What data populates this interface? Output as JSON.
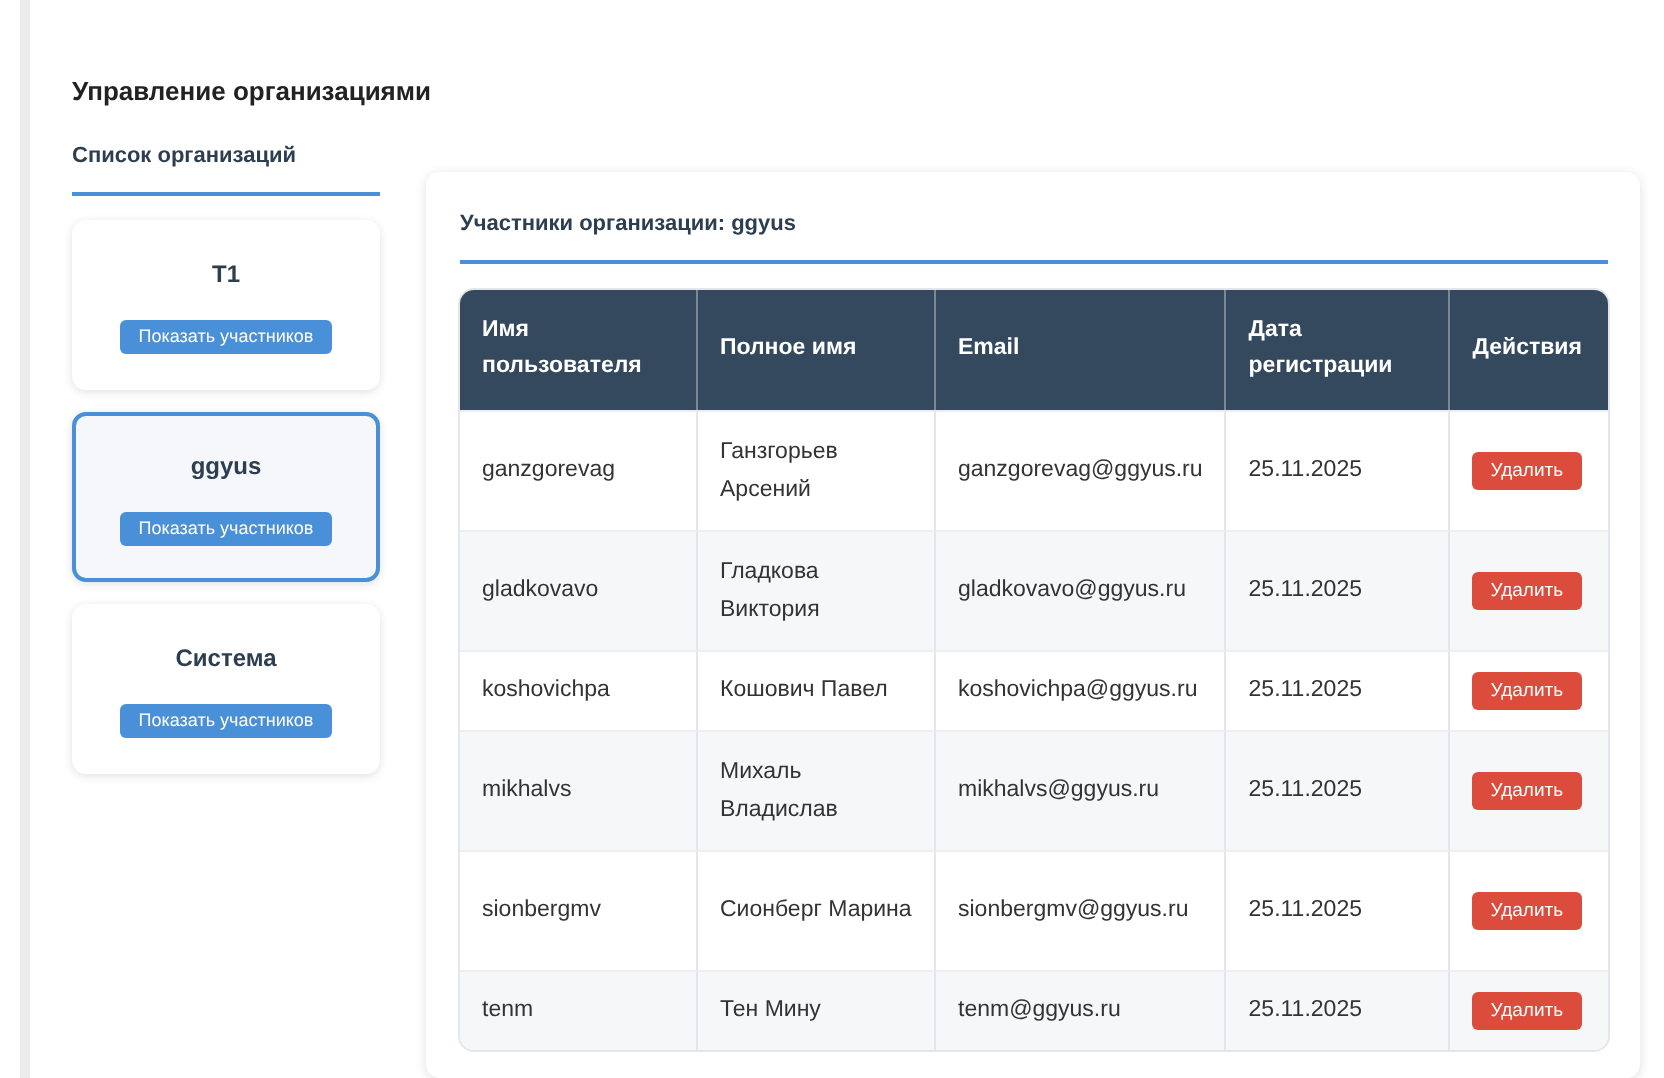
{
  "page_title": "Управление организациями",
  "sidebar": {
    "title": "Список организаций",
    "organizations": [
      {
        "name": "T1",
        "button": "Показать участников",
        "selected": false
      },
      {
        "name": "ggyus",
        "button": "Показать участников",
        "selected": true
      },
      {
        "name": "Система",
        "button": "Показать участников",
        "selected": false
      }
    ]
  },
  "members": {
    "title": "Участники организации: ggyus",
    "columns": [
      "Имя пользователя",
      "Полное имя",
      "Email",
      "Дата регистрации",
      "Действия"
    ],
    "rows": [
      {
        "username": "ganzgorevag",
        "full_name": "Ганзгорьев Арсений",
        "email": "ganzgorevag@ggyus.ru",
        "registered": "25.11.2025",
        "action": "Удалить"
      },
      {
        "username": "gladkovavo",
        "full_name": "Гладкова Виктория",
        "email": "gladkovavo@ggyus.ru",
        "registered": "25.11.2025",
        "action": "Удалить"
      },
      {
        "username": "koshovichpa",
        "full_name": "Кошович Павел",
        "email": "koshovichpa@ggyus.ru",
        "registered": "25.11.2025",
        "action": "Удалить"
      },
      {
        "username": "mikhalvs",
        "full_name": "Михаль Владислав",
        "email": "mikhalvs@ggyus.ru",
        "registered": "25.11.2025",
        "action": "Удалить"
      },
      {
        "username": "sionbergmv",
        "full_name": "Сионберг Марина",
        "email": "sionbergmv@ggyus.ru",
        "registered": "25.11.2025",
        "action": "Удалить"
      },
      {
        "username": "tenm",
        "full_name": "Тен Мину",
        "email": "tenm@ggyus.ru",
        "registered": "25.11.2025",
        "action": "Удалить"
      }
    ]
  }
}
